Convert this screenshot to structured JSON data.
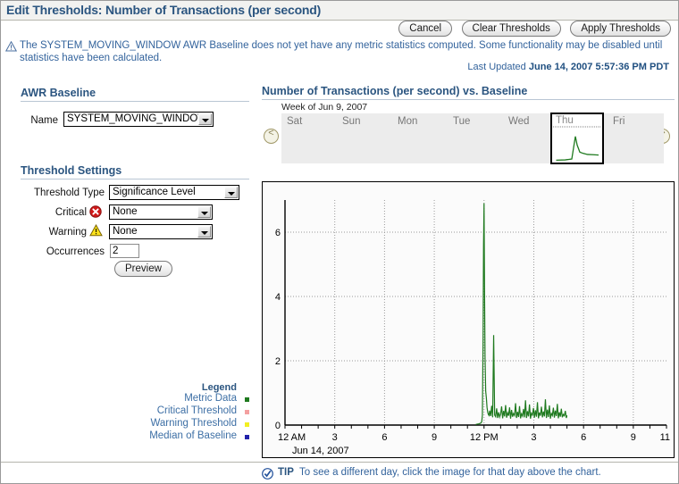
{
  "window": {
    "title": "Edit Thresholds: Number of Transactions (per second)"
  },
  "toolbar": {
    "cancel_label": "Cancel",
    "clear_label": "Clear Thresholds",
    "apply_label": "Apply Thresholds"
  },
  "message": {
    "icon": "warning-triangle-icon",
    "text": "The SYSTEM_MOVING_WINDOW AWR Baseline does not yet have any metric statistics computed. Some functionality may be disabled until statistics have been calculated."
  },
  "last_updated": {
    "label": "Last Updated",
    "value": "June 14, 2007 5:57:36 PM PDT"
  },
  "awr_baseline": {
    "heading": "AWR Baseline",
    "name_label": "Name",
    "name_value": "SYSTEM_MOVING_WINDOW"
  },
  "threshold_settings": {
    "heading": "Threshold Settings",
    "type_label": "Threshold Type",
    "type_value": "Significance Level",
    "critical_label": "Critical",
    "critical_value": "None",
    "warning_label": "Warning",
    "warning_value": "None",
    "occurrences_label": "Occurrences",
    "occurrences_value": "2",
    "preview_label": "Preview"
  },
  "legend": {
    "title": "Legend",
    "items": [
      {
        "label": "Metric Data",
        "color": "#1f7a1f"
      },
      {
        "label": "Critical Threshold",
        "color": "#f4a0a0"
      },
      {
        "label": "Warning Threshold",
        "color": "#f2ef22"
      },
      {
        "label": "Median of Baseline",
        "color": "#2222aa"
      }
    ]
  },
  "chart_panel": {
    "heading": "Number of Transactions (per second) vs. Baseline",
    "week_of": "Week of Jun 9, 2007",
    "prev_label": "<",
    "next_label": ">",
    "days": [
      {
        "label": "Sat",
        "selected": false
      },
      {
        "label": "Sun",
        "selected": false
      },
      {
        "label": "Mon",
        "selected": false
      },
      {
        "label": "Tue",
        "selected": false
      },
      {
        "label": "Wed",
        "selected": false
      },
      {
        "label": "Thu",
        "selected": true
      },
      {
        "label": "Fri",
        "selected": false
      }
    ]
  },
  "tip": {
    "icon": "check-circle-icon",
    "label": "TIP",
    "text": "To see a different day, click the image for that day above the chart."
  },
  "chart_data": {
    "type": "line",
    "title": "Number of Transactions (per second) vs. Baseline",
    "xlabel": "Jun 14, 2007",
    "ylabel": "",
    "date_label": "Jun 14, 2007",
    "series_name": "Metric Data",
    "series_color": "#1f7a1f",
    "grid": true,
    "legend_position": "left-outside",
    "xlim": [
      0,
      23
    ],
    "ylim": [
      0,
      7
    ],
    "yticks": [
      0,
      2,
      4,
      6
    ],
    "ytick_labels": [
      "0",
      "2",
      "4",
      "6"
    ],
    "xticks": [
      0,
      3,
      6,
      9,
      12,
      15,
      18,
      21,
      23
    ],
    "xtick_labels": [
      "12 AM",
      "3",
      "6",
      "9",
      "12 PM",
      "3",
      "6",
      "9",
      "11"
    ],
    "x": [
      11.5,
      11.6,
      11.7,
      11.8,
      11.86,
      11.9,
      11.94,
      11.97,
      12.0,
      12.03,
      12.06,
      12.1,
      12.14,
      12.18,
      12.22,
      12.26,
      12.3,
      12.34,
      12.4,
      12.46,
      12.52,
      12.58,
      12.64,
      12.7,
      12.76,
      12.82,
      12.88,
      12.94,
      13.0,
      13.06,
      13.12,
      13.18,
      13.24,
      13.3,
      13.36,
      13.42,
      13.48,
      13.54,
      13.6,
      13.66,
      13.72,
      13.78,
      13.84,
      13.9,
      13.96,
      14.02,
      14.08,
      14.14,
      14.2,
      14.26,
      14.32,
      14.38,
      14.44,
      14.5,
      14.56,
      14.62,
      14.68,
      14.74,
      14.8,
      14.86,
      14.92,
      14.98,
      15.04,
      15.1,
      15.16,
      15.22,
      15.28,
      15.34,
      15.4,
      15.46,
      15.52,
      15.58,
      15.64,
      15.7,
      15.76,
      15.82,
      15.88,
      15.94,
      16.0,
      16.06,
      16.12,
      16.18,
      16.24,
      16.3,
      16.36,
      16.42,
      16.48,
      16.54,
      16.6,
      16.66,
      16.72,
      16.78,
      16.84,
      16.9,
      16.96,
      17.0
    ],
    "y": [
      0.02,
      0.03,
      0.04,
      0.06,
      0.1,
      0.3,
      2.5,
      5.6,
      6.9,
      4.2,
      2.1,
      1.05,
      0.85,
      0.55,
      0.4,
      0.33,
      0.3,
      0.45,
      0.28,
      0.6,
      0.24,
      2.8,
      0.31,
      0.26,
      0.52,
      0.22,
      0.4,
      0.25,
      0.34,
      0.58,
      0.21,
      0.44,
      0.27,
      0.62,
      0.23,
      0.38,
      0.29,
      0.55,
      0.2,
      0.47,
      0.26,
      0.36,
      0.3,
      0.68,
      0.22,
      0.41,
      0.25,
      0.59,
      0.21,
      0.35,
      0.28,
      0.5,
      0.24,
      0.77,
      0.22,
      0.43,
      0.27,
      0.64,
      0.2,
      0.37,
      0.31,
      0.53,
      0.23,
      0.46,
      0.26,
      0.71,
      0.21,
      0.39,
      0.29,
      0.57,
      0.24,
      0.42,
      0.27,
      0.8,
      0.22,
      0.48,
      0.25,
      0.61,
      0.2,
      0.36,
      0.3,
      0.54,
      0.23,
      0.45,
      0.28,
      0.66,
      0.21,
      0.4,
      0.26,
      0.51,
      0.24,
      0.33,
      0.29,
      0.44,
      0.22,
      0.3
    ],
    "thumbnail": {
      "day": "Thu",
      "median_line_visible": true,
      "x": [
        0.05,
        0.25,
        0.4,
        0.48,
        0.52,
        0.58,
        0.65,
        0.75,
        0.88,
        1.0
      ],
      "y": [
        0.02,
        0.03,
        0.06,
        0.85,
        0.55,
        0.3,
        0.26,
        0.22,
        0.21,
        0.2
      ]
    }
  }
}
